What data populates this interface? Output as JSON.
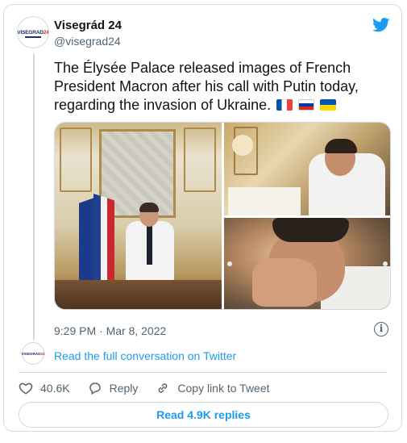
{
  "account": {
    "name": "Visegrád 24",
    "handle": "@visegrad24",
    "avatar_text_main": "VISEGRAD",
    "avatar_text_accent": "24"
  },
  "tweet": {
    "text": "The Élysée Palace released images of French President Macron after his call with Putin today, regarding the invasion of Ukraine.",
    "flags": [
      "fr-flag",
      "ru-flag",
      "ua-flag"
    ],
    "timestamp": "9:29 PM · Mar 8, 2022"
  },
  "conversation": {
    "link_label": "Read the full conversation on Twitter"
  },
  "actions": {
    "like_count": "40.6K",
    "reply_label": "Reply",
    "copy_label": "Copy link to Tweet"
  },
  "replies_button": {
    "label": "Read 4.9K replies"
  },
  "colors": {
    "accent": "#1d9bf0",
    "secondary_text": "#536471",
    "border": "#cfd9de"
  },
  "icons": {
    "brand": "twitter-bird-icon",
    "info": "info-icon",
    "like": "heart-icon",
    "reply": "reply-bubble-icon",
    "copy": "link-icon"
  }
}
